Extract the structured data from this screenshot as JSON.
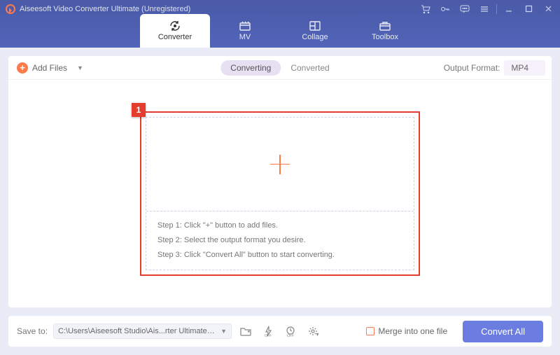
{
  "titlebar": {
    "title": "Aiseesoft Video Converter Ultimate (Unregistered)"
  },
  "tabs": {
    "converter": "Converter",
    "mv": "MV",
    "collage": "Collage",
    "toolbox": "Toolbox"
  },
  "toolbar": {
    "add_files": "Add Files",
    "converting": "Converting",
    "converted": "Converted",
    "output_format_label": "Output Format:",
    "output_format_value": "MP4"
  },
  "annotation": {
    "badge": "1"
  },
  "steps": {
    "s1": "Step 1: Click \"+\" button to add files.",
    "s2": "Step 2: Select the output format you desire.",
    "s3": "Step 3: Click \"Convert All\" button to start converting."
  },
  "bottom": {
    "save_to_label": "Save to:",
    "path": "C:\\Users\\Aiseesoft Studio\\Ais...rter Ultimate\\Converted",
    "merge_label": "Merge into one file",
    "convert_all": "Convert All"
  }
}
